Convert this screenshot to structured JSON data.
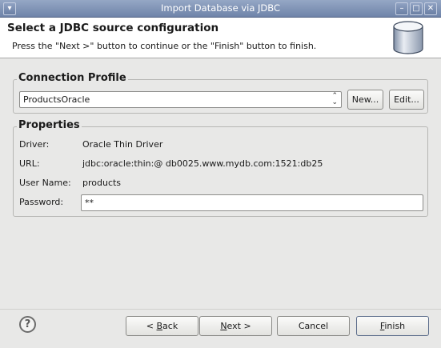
{
  "window": {
    "title": "Import Database via JDBC"
  },
  "header": {
    "title": "Select a JDBC source configuration",
    "message": "Press the \"Next >\" button to continue or the \"Finish\" button to finish."
  },
  "connection_profile": {
    "label": "Connection Profile",
    "selected": "ProductsOracle",
    "new_button": "New...",
    "edit_button": "Edit..."
  },
  "properties": {
    "label": "Properties",
    "driver_label": "Driver:",
    "driver_value": "Oracle Thin Driver",
    "url_label": "URL:",
    "url_value": "jdbc:oracle:thin:@ db0025.www.mydb.com:1521:db25",
    "username_label": "User Name:",
    "username_value": "products",
    "password_label": "Password:",
    "password_value": "**"
  },
  "footer": {
    "back_prefix": "< ",
    "back_mnemonic": "B",
    "back_rest": "ack",
    "next_mnemonic": "N",
    "next_rest": "ext >",
    "cancel_label": "Cancel",
    "finish_mnemonic": "F",
    "finish_rest": "inish",
    "help_glyph": "?"
  }
}
